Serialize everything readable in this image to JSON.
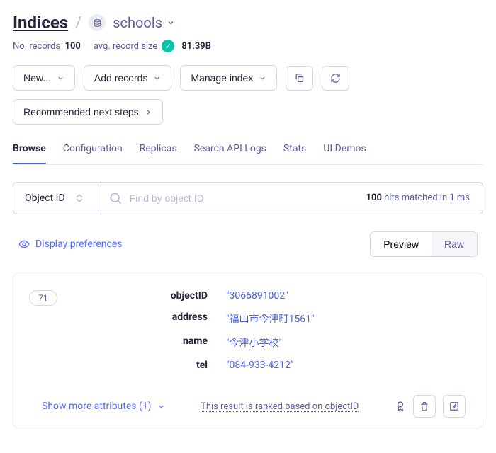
{
  "breadcrumb": {
    "root": "Indices",
    "index_name": "schools"
  },
  "stats": {
    "records_label": "No. records",
    "records_value": "100",
    "avg_label": "avg. record size",
    "avg_value": "81.39B"
  },
  "toolbar": {
    "new": "New...",
    "add_records": "Add records",
    "manage_index": "Manage index",
    "recommended": "Recommended next steps"
  },
  "tabs": {
    "browse": "Browse",
    "configuration": "Configuration",
    "replicas": "Replicas",
    "search_api_logs": "Search API Logs",
    "stats": "Stats",
    "ui_demos": "UI Demos"
  },
  "search": {
    "mode_label": "Object ID",
    "placeholder": "Find by object ID",
    "result_summary": "100 hits matched in 1 ms"
  },
  "prefs": {
    "display": "Display preferences",
    "preview": "Preview",
    "raw": "Raw"
  },
  "record": {
    "badge": "71",
    "fields": {
      "objectID": {
        "k": "objectID",
        "v": "\"3066891002\""
      },
      "address": {
        "k": "address",
        "v": "\"福山市今津町1561\""
      },
      "name": {
        "k": "name",
        "v": "\"今津小学校\""
      },
      "tel": {
        "k": "tel",
        "v": "\"084-933-4212\""
      }
    },
    "show_more": "Show more attributes (1)",
    "rank_info": "This result is ranked based on objectID"
  }
}
